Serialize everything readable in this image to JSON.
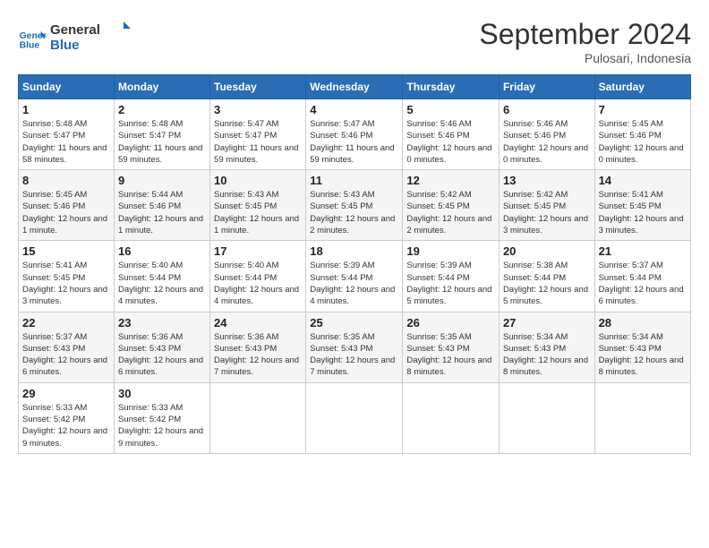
{
  "header": {
    "logo_line1": "General",
    "logo_line2": "Blue",
    "month_title": "September 2024",
    "location": "Pulosari, Indonesia"
  },
  "days_of_week": [
    "Sunday",
    "Monday",
    "Tuesday",
    "Wednesday",
    "Thursday",
    "Friday",
    "Saturday"
  ],
  "weeks": [
    [
      {
        "day": "1",
        "sunrise": "5:48 AM",
        "sunset": "5:47 PM",
        "daylight": "11 hours and 58 minutes."
      },
      {
        "day": "2",
        "sunrise": "5:48 AM",
        "sunset": "5:47 PM",
        "daylight": "11 hours and 59 minutes."
      },
      {
        "day": "3",
        "sunrise": "5:47 AM",
        "sunset": "5:47 PM",
        "daylight": "11 hours and 59 minutes."
      },
      {
        "day": "4",
        "sunrise": "5:47 AM",
        "sunset": "5:46 PM",
        "daylight": "11 hours and 59 minutes."
      },
      {
        "day": "5",
        "sunrise": "5:46 AM",
        "sunset": "5:46 PM",
        "daylight": "12 hours and 0 minutes."
      },
      {
        "day": "6",
        "sunrise": "5:46 AM",
        "sunset": "5:46 PM",
        "daylight": "12 hours and 0 minutes."
      },
      {
        "day": "7",
        "sunrise": "5:45 AM",
        "sunset": "5:46 PM",
        "daylight": "12 hours and 0 minutes."
      }
    ],
    [
      {
        "day": "8",
        "sunrise": "5:45 AM",
        "sunset": "5:46 PM",
        "daylight": "12 hours and 1 minute."
      },
      {
        "day": "9",
        "sunrise": "5:44 AM",
        "sunset": "5:46 PM",
        "daylight": "12 hours and 1 minute."
      },
      {
        "day": "10",
        "sunrise": "5:43 AM",
        "sunset": "5:45 PM",
        "daylight": "12 hours and 1 minute."
      },
      {
        "day": "11",
        "sunrise": "5:43 AM",
        "sunset": "5:45 PM",
        "daylight": "12 hours and 2 minutes."
      },
      {
        "day": "12",
        "sunrise": "5:42 AM",
        "sunset": "5:45 PM",
        "daylight": "12 hours and 2 minutes."
      },
      {
        "day": "13",
        "sunrise": "5:42 AM",
        "sunset": "5:45 PM",
        "daylight": "12 hours and 3 minutes."
      },
      {
        "day": "14",
        "sunrise": "5:41 AM",
        "sunset": "5:45 PM",
        "daylight": "12 hours and 3 minutes."
      }
    ],
    [
      {
        "day": "15",
        "sunrise": "5:41 AM",
        "sunset": "5:45 PM",
        "daylight": "12 hours and 3 minutes."
      },
      {
        "day": "16",
        "sunrise": "5:40 AM",
        "sunset": "5:44 PM",
        "daylight": "12 hours and 4 minutes."
      },
      {
        "day": "17",
        "sunrise": "5:40 AM",
        "sunset": "5:44 PM",
        "daylight": "12 hours and 4 minutes."
      },
      {
        "day": "18",
        "sunrise": "5:39 AM",
        "sunset": "5:44 PM",
        "daylight": "12 hours and 4 minutes."
      },
      {
        "day": "19",
        "sunrise": "5:39 AM",
        "sunset": "5:44 PM",
        "daylight": "12 hours and 5 minutes."
      },
      {
        "day": "20",
        "sunrise": "5:38 AM",
        "sunset": "5:44 PM",
        "daylight": "12 hours and 5 minutes."
      },
      {
        "day": "21",
        "sunrise": "5:37 AM",
        "sunset": "5:44 PM",
        "daylight": "12 hours and 6 minutes."
      }
    ],
    [
      {
        "day": "22",
        "sunrise": "5:37 AM",
        "sunset": "5:43 PM",
        "daylight": "12 hours and 6 minutes."
      },
      {
        "day": "23",
        "sunrise": "5:36 AM",
        "sunset": "5:43 PM",
        "daylight": "12 hours and 6 minutes."
      },
      {
        "day": "24",
        "sunrise": "5:36 AM",
        "sunset": "5:43 PM",
        "daylight": "12 hours and 7 minutes."
      },
      {
        "day": "25",
        "sunrise": "5:35 AM",
        "sunset": "5:43 PM",
        "daylight": "12 hours and 7 minutes."
      },
      {
        "day": "26",
        "sunrise": "5:35 AM",
        "sunset": "5:43 PM",
        "daylight": "12 hours and 8 minutes."
      },
      {
        "day": "27",
        "sunrise": "5:34 AM",
        "sunset": "5:43 PM",
        "daylight": "12 hours and 8 minutes."
      },
      {
        "day": "28",
        "sunrise": "5:34 AM",
        "sunset": "5:43 PM",
        "daylight": "12 hours and 8 minutes."
      }
    ],
    [
      {
        "day": "29",
        "sunrise": "5:33 AM",
        "sunset": "5:42 PM",
        "daylight": "12 hours and 9 minutes."
      },
      {
        "day": "30",
        "sunrise": "5:33 AM",
        "sunset": "5:42 PM",
        "daylight": "12 hours and 9 minutes."
      },
      null,
      null,
      null,
      null,
      null
    ]
  ]
}
